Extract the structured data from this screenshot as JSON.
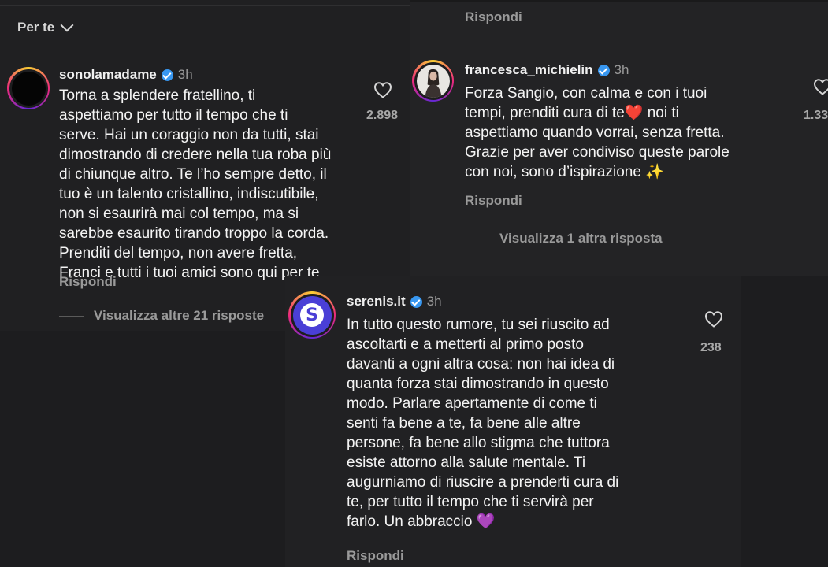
{
  "header": {
    "sort_label": "Per te"
  },
  "comments": [
    {
      "username": "sonolamadame",
      "time": "3h",
      "text": "Torna a splendere fratellino, ti\naspettiamo per tutto il tempo che ti\nserve. Hai un coraggio non da tutti, stai\ndimostrando di credere nella tua roba più\ndi chiunque altro. Te l’ho sempre detto, il\ntuo è un talento cristallino, indiscutibile,\nnon si esaurirà mai col tempo, ma si\nsarebbe esaurito tirando troppo la corda.\nPrenditi del tempo, non avere fretta,\nFranci e tutti i tuoi amici sono qui per te",
      "likes": "2.898",
      "reply_label": "Rispondi",
      "view_replies": "Visualizza altre 21 risposte"
    },
    {
      "username": "francesca_michielin",
      "time": "3h",
      "text": "Forza Sangio, con calma e con i tuoi\ntempi, prenditi cura di te❤️ noi ti\naspettiamo quando vorrai, senza fretta.\nGrazie per aver condiviso queste parole\ncon noi, sono d’ispirazione ✨",
      "likes": "1.33",
      "reply_label": "Rispondi",
      "view_replies": "Visualizza 1 altra risposta",
      "prev_reply_label": "Rispondi"
    },
    {
      "username": "serenis.it",
      "time": "3h",
      "text": "In tutto questo rumore, tu sei riuscito ad\nascoltarti e a metterti al primo posto\ndavanti a ogni altra cosa: non hai idea di\nquanta forza stai dimostrando in questo\nmodo. Parlare apertamente di come ti\nsenti fa bene a te, fa bene alle altre\npersone, fa bene allo stigma che tuttora\nesiste attorno alla salute mentale. Ti\naugurniamo di riuscire a prenderti cura di\nte, per tutto il tempo che ti servirà per\nfarlo. Un abbraccio 💜",
      "likes": "238",
      "reply_label": "Rispondi",
      "avatar_letter": "S",
      "avatar_color": "#4a3fd6"
    }
  ]
}
